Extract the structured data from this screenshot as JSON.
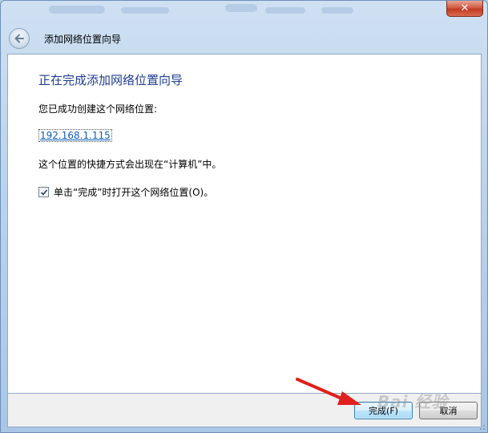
{
  "window": {
    "nav_title": "添加网络位置向导",
    "close_glyph": "✕"
  },
  "content": {
    "heading": "正在完成添加网络位置向导",
    "success_text": "您已成功创建这个网络位置:",
    "location_link": "192.168.1.115",
    "shortcut_text": "这个位置的快捷方式会出现在“计算机”中。",
    "open_checkbox": {
      "label": "单击“完成”时打开这个网络位置(O)。",
      "checked": true
    }
  },
  "footer": {
    "finish_label": "完成(F)",
    "cancel_label": "取消"
  },
  "watermark": "Bai 经验",
  "icons": {
    "back": "back-arrow-icon",
    "close": "close-icon",
    "check": "checkmark-icon",
    "annotation": "red-arrow-annotation"
  },
  "colors": {
    "heading": "#1e3d8f",
    "link": "#0d5fb6",
    "close_button": "#c13b23",
    "annotation_arrow": "#e0201c"
  }
}
